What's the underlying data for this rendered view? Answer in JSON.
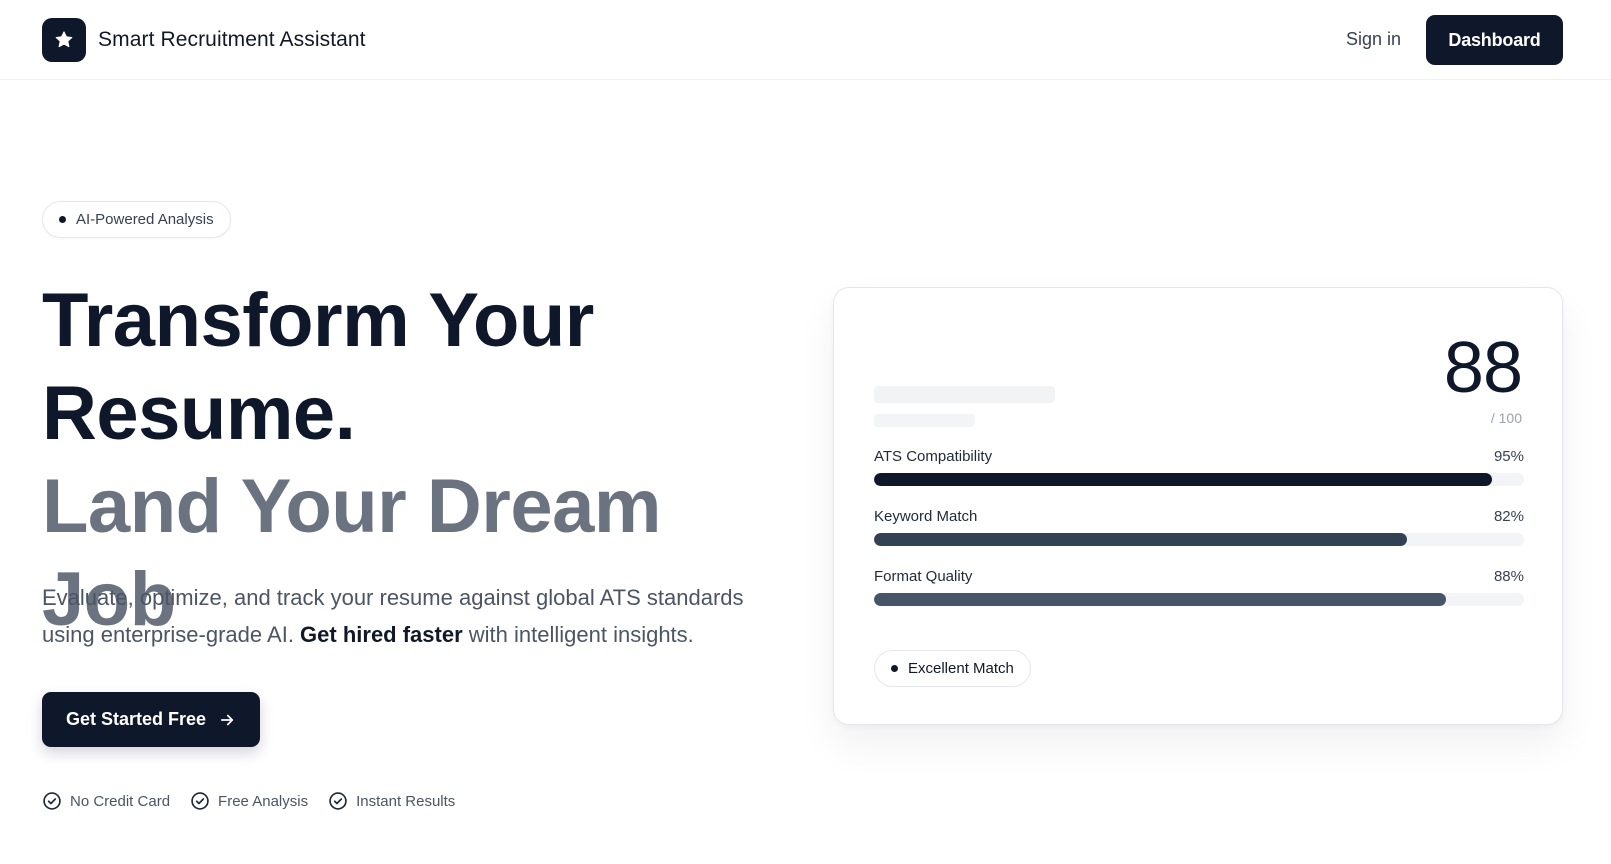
{
  "header": {
    "app_title": "Smart Recruitment Assistant",
    "logo_icon": "star-icon",
    "signin_label": "Sign in",
    "dashboard_label": "Dashboard"
  },
  "hero": {
    "badge": "AI-Powered Analysis",
    "title_line1": "Transform Your",
    "title_line2": "Resume.",
    "title_line3": "Land Your Dream Job",
    "desc_part1": "Evaluate, optimize, and track your resume against global ATS standards using enterprise-grade AI. ",
    "desc_bold": "Get hired faster",
    "desc_part2": " with intelligent insights.",
    "cta_label": "Get Started Free",
    "cta_icon": "arrow-right-icon",
    "perks": [
      {
        "label": "No Credit Card",
        "icon": "check-circle-icon"
      },
      {
        "label": "Free Analysis",
        "icon": "check-circle-icon"
      },
      {
        "label": "Instant Results",
        "icon": "check-circle-icon"
      }
    ]
  },
  "score_card": {
    "score": "88",
    "score_max": "/ 100",
    "metrics": [
      {
        "label": "ATS Compatibility",
        "value_text": "95%",
        "value": 95,
        "color": "#0f172a"
      },
      {
        "label": "Keyword Match",
        "value_text": "82%",
        "value": 82,
        "color": "#334155"
      },
      {
        "label": "Format Quality",
        "value_text": "88%",
        "value": 88,
        "color": "#475569"
      }
    ],
    "status_badge": "Excellent Match"
  },
  "colors": {
    "primary": "#0f172a",
    "muted_heading": "#6b7280",
    "body_text": "#4b5563",
    "track": "#f3f4f6"
  }
}
